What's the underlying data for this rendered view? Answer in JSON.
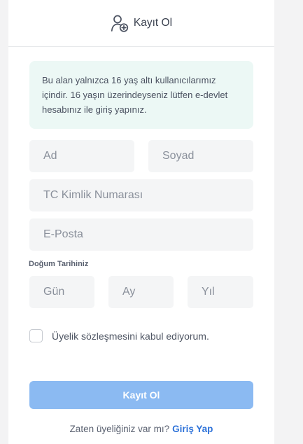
{
  "header": {
    "icon": "user-add-icon",
    "title": "Kayıt Ol"
  },
  "notice": {
    "text": "Bu alan yalnızca 16 yaş altı kullanıcılarımız içindir. 16 yaşın üzerindeyseniz lütfen e-devlet hesabınız ile giriş yapınız."
  },
  "form": {
    "first_name": {
      "placeholder": "Ad",
      "value": ""
    },
    "last_name": {
      "placeholder": "Soyad",
      "value": ""
    },
    "tc_id": {
      "placeholder": "TC Kimlik Numarası",
      "value": ""
    },
    "email": {
      "placeholder": "E-Posta",
      "value": ""
    },
    "birthdate_label": "Doğum Tarihiniz",
    "day": {
      "placeholder": "Gün",
      "value": ""
    },
    "month": {
      "placeholder": "Ay",
      "value": ""
    },
    "year": {
      "placeholder": "Yıl",
      "value": ""
    },
    "agreement_label": "Üyelik sözleşmesini kabul ediyorum.",
    "agreement_checked": false,
    "submit_label": "Kayıt Ol"
  },
  "footer": {
    "prompt": "Zaten üyeliğiniz var mı?",
    "login_link": "Giriş Yap"
  },
  "colors": {
    "accent": "#2f73d9",
    "submit_disabled": "#8bbaf2",
    "notice_bg": "#ecf8f5"
  }
}
